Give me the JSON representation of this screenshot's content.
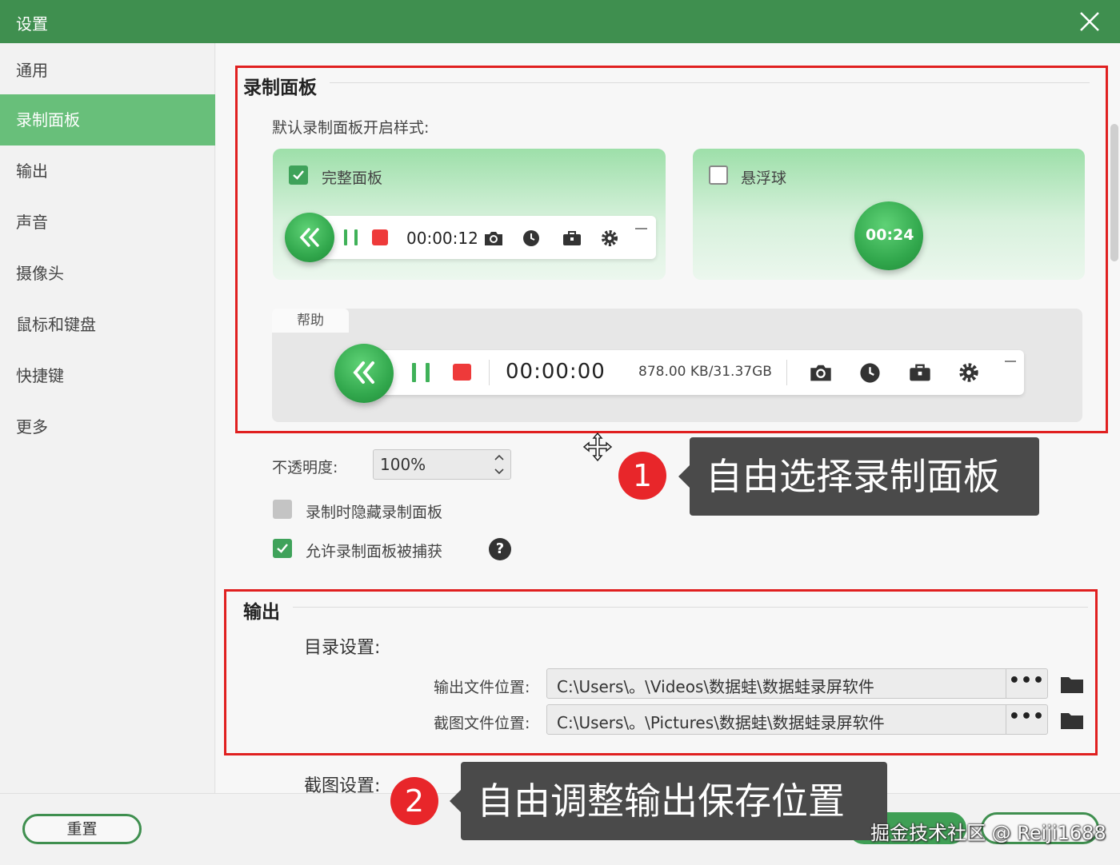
{
  "window": {
    "title": "设置"
  },
  "sidebar": {
    "items": [
      {
        "label": "通用"
      },
      {
        "label": "录制面板",
        "active": true
      },
      {
        "label": "输出"
      },
      {
        "label": "声音"
      },
      {
        "label": "摄像头"
      },
      {
        "label": "鼠标和键盘"
      },
      {
        "label": "快捷键"
      },
      {
        "label": "更多"
      }
    ]
  },
  "record_panel": {
    "title": "录制面板",
    "default_style_label": "默认录制面板开启样式:",
    "full_panel": {
      "label": "完整面板",
      "checked": true,
      "timer": "00:00:12"
    },
    "float_ball": {
      "label": "悬浮球",
      "checked": false,
      "timer": "00:24"
    },
    "help": {
      "tab_label": "帮助",
      "timer": "00:00:00",
      "storage": "878.00 KB/31.37GB"
    },
    "opacity": {
      "label": "不透明度:",
      "value": "100%"
    },
    "hide_while_recording": {
      "label": "录制时隐藏录制面板",
      "checked": false
    },
    "allow_capture": {
      "label": "允许录制面板被捕获",
      "checked": true
    }
  },
  "output": {
    "title": "输出",
    "dir_settings_label": "目录设置:",
    "output_path": {
      "label": "输出文件位置:",
      "value": "C:\\Users\\。\\Videos\\数据蛙\\数据蛙录屏软件",
      "browse": "•••"
    },
    "screenshot_path": {
      "label": "截图文件位置:",
      "value": "C:\\Users\\。\\Pictures\\数据蛙\\数据蛙录屏软件",
      "browse": "•••"
    },
    "screenshot_settings_label": "截图设置:"
  },
  "footer": {
    "reset_label": "重置"
  },
  "callouts": [
    {
      "num": "1",
      "text": "自由选择录制面板"
    },
    {
      "num": "2",
      "text": "自由调整输出保存位置"
    }
  ],
  "watermark": "掘金技术社区 @ Reiji1688",
  "colors": {
    "titlebar": "#3f8f4f",
    "accent": "#68bf7a",
    "highlight": "#e02020",
    "callout_bg": "#4a4a4a"
  }
}
